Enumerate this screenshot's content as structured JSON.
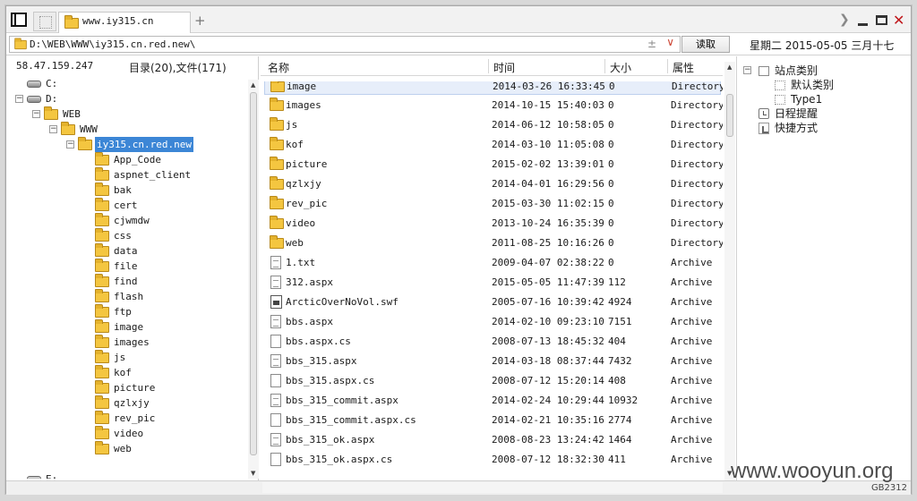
{
  "tabs": {
    "active_label": "www.iy315.cn",
    "add_label": "+"
  },
  "address": {
    "path": "D:\\WEB\\WWW\\iy315.cn.red.new\\",
    "read_button": "读取",
    "plus_minus": "±",
    "dropdown": "∨"
  },
  "date_line": "星期二  2015-05-05  三月十七",
  "left": {
    "ip": "58.47.159.247",
    "counts": "目录(20),文件(171)",
    "tree": [
      {
        "label": "C:",
        "type": "drive",
        "level": 0,
        "exp": ""
      },
      {
        "label": "D:",
        "type": "drive",
        "level": 0,
        "exp": "−"
      },
      {
        "label": "WEB",
        "type": "folder",
        "level": 1,
        "exp": "−"
      },
      {
        "label": "WWW",
        "type": "folder",
        "level": 2,
        "exp": "−"
      },
      {
        "label": "iy315.cn.red.new",
        "type": "folder",
        "level": 3,
        "exp": "−",
        "selected": true
      },
      {
        "label": "App_Code",
        "type": "folder",
        "level": 4
      },
      {
        "label": "aspnet_client",
        "type": "folder",
        "level": 4
      },
      {
        "label": "bak",
        "type": "folder",
        "level": 4
      },
      {
        "label": "cert",
        "type": "folder",
        "level": 4
      },
      {
        "label": "cjwmdw",
        "type": "folder",
        "level": 4
      },
      {
        "label": "css",
        "type": "folder",
        "level": 4
      },
      {
        "label": "data",
        "type": "folder",
        "level": 4
      },
      {
        "label": "file",
        "type": "folder",
        "level": 4
      },
      {
        "label": "find",
        "type": "folder",
        "level": 4
      },
      {
        "label": "flash",
        "type": "folder",
        "level": 4
      },
      {
        "label": "ftp",
        "type": "folder",
        "level": 4
      },
      {
        "label": "image",
        "type": "folder",
        "level": 4
      },
      {
        "label": "images",
        "type": "folder",
        "level": 4
      },
      {
        "label": "js",
        "type": "folder",
        "level": 4
      },
      {
        "label": "kof",
        "type": "folder",
        "level": 4
      },
      {
        "label": "picture",
        "type": "folder",
        "level": 4
      },
      {
        "label": "qzlxjy",
        "type": "folder",
        "level": 4
      },
      {
        "label": "rev_pic",
        "type": "folder",
        "level": 4
      },
      {
        "label": "video",
        "type": "folder",
        "level": 4
      },
      {
        "label": "web",
        "type": "folder",
        "level": 4
      },
      {
        "label": "",
        "type": "spacer",
        "level": 0
      },
      {
        "label": "E:",
        "type": "drive",
        "level": 0,
        "exp": ""
      }
    ]
  },
  "files": {
    "columns": {
      "name": "名称",
      "time": "时间",
      "size": "大小",
      "attr": "属性"
    },
    "rows": [
      {
        "name": "image",
        "time": "2014-03-26 16:33:45",
        "size": "0",
        "attr": "Directory",
        "icon": "folder",
        "selected": true
      },
      {
        "name": "images",
        "time": "2014-10-15 15:40:03",
        "size": "0",
        "attr": "Directory",
        "icon": "folder"
      },
      {
        "name": "js",
        "time": "2014-06-12 10:58:05",
        "size": "0",
        "attr": "Directory",
        "icon": "folder"
      },
      {
        "name": "kof",
        "time": "2014-03-10 11:05:08",
        "size": "0",
        "attr": "Directory",
        "icon": "folder"
      },
      {
        "name": "picture",
        "time": "2015-02-02 13:39:01",
        "size": "0",
        "attr": "Directory",
        "icon": "folder"
      },
      {
        "name": "qzlxjy",
        "time": "2014-04-01 16:29:56",
        "size": "0",
        "attr": "Directory",
        "icon": "folder"
      },
      {
        "name": "rev_pic",
        "time": "2015-03-30 11:02:15",
        "size": "0",
        "attr": "Directory",
        "icon": "folder"
      },
      {
        "name": "video",
        "time": "2013-10-24 16:35:39",
        "size": "0",
        "attr": "Directory",
        "icon": "folder"
      },
      {
        "name": "web",
        "time": "2011-08-25 10:16:26",
        "size": "0",
        "attr": "Directory",
        "icon": "folder"
      },
      {
        "name": "1.txt",
        "time": "2009-04-07 02:38:22",
        "size": "0",
        "attr": "Archive",
        "icon": "text"
      },
      {
        "name": "312.aspx",
        "time": "2015-05-05 11:47:39",
        "size": "112",
        "attr": "Archive",
        "icon": "text"
      },
      {
        "name": "ArcticOverNoVol.swf",
        "time": "2005-07-16 10:39:42",
        "size": "4924",
        "attr": "Archive",
        "icon": "swf"
      },
      {
        "name": "bbs.aspx",
        "time": "2014-02-10 09:23:10",
        "size": "7151",
        "attr": "Archive",
        "icon": "text"
      },
      {
        "name": "bbs.aspx.cs",
        "time": "2008-07-13 18:45:32",
        "size": "404",
        "attr": "Archive",
        "icon": "blank"
      },
      {
        "name": "bbs_315.aspx",
        "time": "2014-03-18 08:37:44",
        "size": "7432",
        "attr": "Archive",
        "icon": "text"
      },
      {
        "name": "bbs_315.aspx.cs",
        "time": "2008-07-12 15:20:14",
        "size": "408",
        "attr": "Archive",
        "icon": "blank"
      },
      {
        "name": "bbs_315_commit.aspx",
        "time": "2014-02-24 10:29:44",
        "size": "10932",
        "attr": "Archive",
        "icon": "text"
      },
      {
        "name": "bbs_315_commit.aspx.cs",
        "time": "2014-02-21 10:35:16",
        "size": "2774",
        "attr": "Archive",
        "icon": "blank"
      },
      {
        "name": "bbs_315_ok.aspx",
        "time": "2008-08-23 13:24:42",
        "size": "1464",
        "attr": "Archive",
        "icon": "text"
      },
      {
        "name": "bbs_315_ok.aspx.cs",
        "time": "2008-07-12 18:32:30",
        "size": "411",
        "attr": "Archive",
        "icon": "blank"
      }
    ]
  },
  "right": {
    "items": [
      {
        "label": "站点类别",
        "icon": "square",
        "level": 0,
        "exp": "−"
      },
      {
        "label": "默认类别",
        "icon": "dotted-square",
        "level": 1
      },
      {
        "label": "Type1",
        "icon": "dotted-square",
        "level": 1
      },
      {
        "label": "日程提醒",
        "icon": "clock",
        "level": 0
      },
      {
        "label": "快捷方式",
        "icon": "shortcut",
        "level": 0
      }
    ]
  },
  "status": {
    "text": "GB2312"
  },
  "watermark": "www.wooyun.org"
}
